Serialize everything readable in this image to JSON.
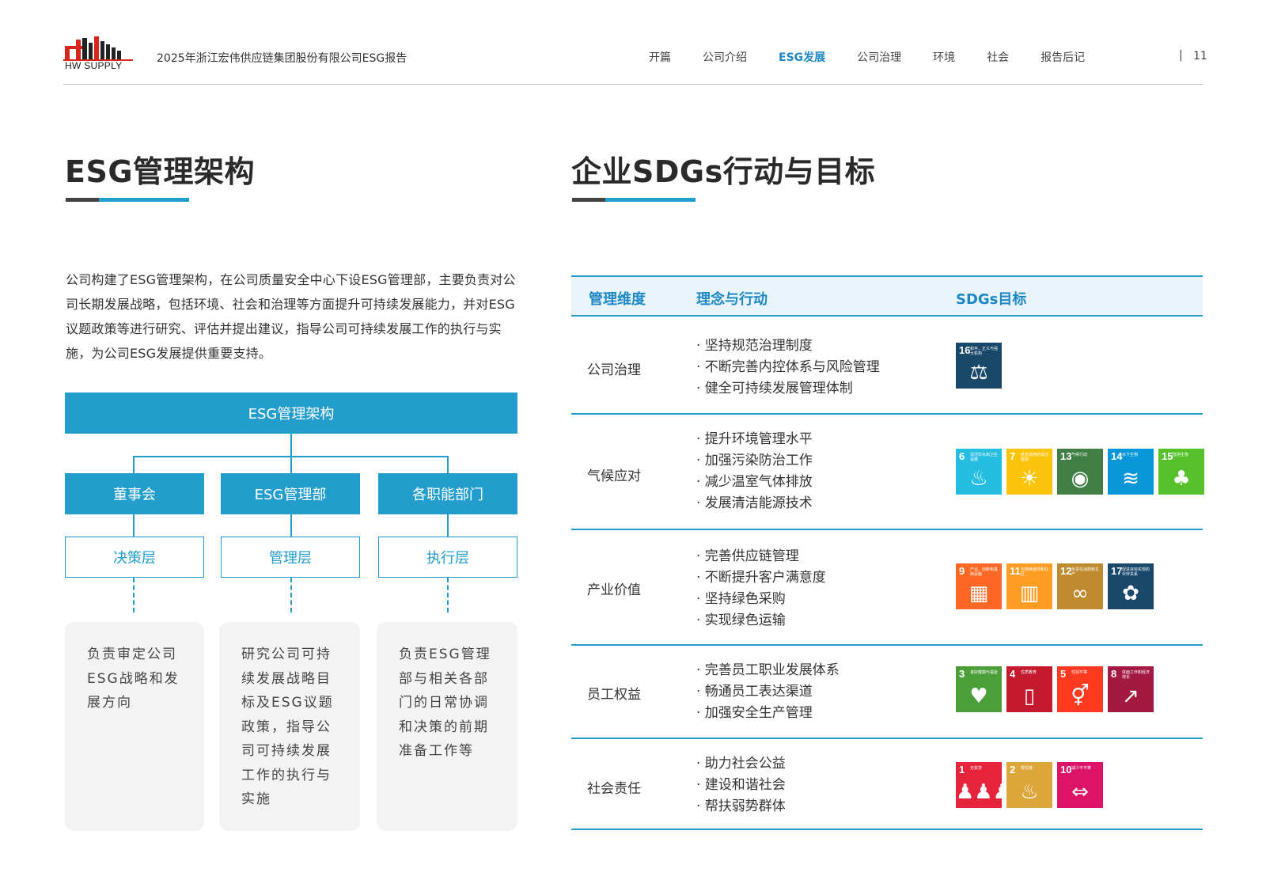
{
  "header": {
    "logo_text": "HW SUPPLY",
    "report_title": "2025年浙江宏伟供应链集团股份有限公司ESG报告",
    "nav": [
      {
        "label": "开篇",
        "active": false
      },
      {
        "label": "公司介绍",
        "active": false
      },
      {
        "label": "ESG发展",
        "active": true
      },
      {
        "label": "公司治理",
        "active": false
      },
      {
        "label": "环境",
        "active": false
      },
      {
        "label": "社会",
        "active": false
      },
      {
        "label": "报告后记",
        "active": false
      }
    ],
    "separator": "|",
    "page_number": "11"
  },
  "left": {
    "title": "ESG管理架构",
    "intro": "公司构建了ESG管理架构，在公司质量安全中心下设ESG管理部，主要负责对公司长期发展战略，包括环境、社会和治理等方面提升可持续发展能力，并对ESG议题政策等进行研究、评估并提出建议，指导公司可持续发展工作的执行与实施，为公司ESG发展提供重要支持。",
    "org": {
      "root": "ESG管理架构",
      "branches": [
        {
          "name": "董事会",
          "layer": "决策层",
          "desc": "负责审定公司ESG战略和发展方向"
        },
        {
          "name": "ESG管理部",
          "layer": "管理层",
          "desc": "研究公司可持续发展战略目标及ESG议题政策，指导公司可持续发展工作的执行与实施"
        },
        {
          "name": "各职能部门",
          "layer": "执行层",
          "desc": "负责ESG管理部与相关各部门的日常协调和决策的前期准备工作等"
        }
      ]
    }
  },
  "right": {
    "title": "企业SDGs行动与目标",
    "columns": [
      "管理维度",
      "理念与行动",
      "SDGs目标"
    ],
    "rows": [
      {
        "dimension": "公司治理",
        "actions": [
          "· 坚持规范治理制度",
          "· 不断完善内控体系与风险管理",
          "· 健全可持续发展管理体制"
        ],
        "sdgs": [
          {
            "num": "16",
            "label": "和平、正义与强大机构",
            "color": "#19486a",
            "icon": "dove-icon",
            "glyph": "⚖"
          }
        ]
      },
      {
        "dimension": "气候应对",
        "actions": [
          "· 提升环境管理水平",
          "· 加强污染防治工作",
          "· 减少温室气体排放",
          "· 发展清洁能源技术"
        ],
        "sdgs": [
          {
            "num": "6",
            "label": "清洁饮水和卫生设施",
            "color": "#26bde2",
            "icon": "water-icon",
            "glyph": "♨"
          },
          {
            "num": "7",
            "label": "经济适用的清洁能源",
            "color": "#fcc30b",
            "icon": "sun-icon",
            "glyph": "☀"
          },
          {
            "num": "13",
            "label": "气候行动",
            "color": "#3f7e44",
            "icon": "eye-globe-icon",
            "glyph": "◉"
          },
          {
            "num": "14",
            "label": "水下生物",
            "color": "#0a97d9",
            "icon": "fish-icon",
            "glyph": "≋"
          },
          {
            "num": "15",
            "label": "陆地生物",
            "color": "#56c02b",
            "icon": "tree-icon",
            "glyph": "♣"
          }
        ]
      },
      {
        "dimension": "产业价值",
        "actions": [
          "· 完善供应链管理",
          "· 不断提升客户满意度",
          "· 坚持绿色采购",
          "· 实现绿色运输"
        ],
        "sdgs": [
          {
            "num": "9",
            "label": "产业、创新和基础设施",
            "color": "#fd6925",
            "icon": "cubes-icon",
            "glyph": "▦"
          },
          {
            "num": "11",
            "label": "可持续城市和社区",
            "color": "#fd9d24",
            "icon": "city-icon",
            "glyph": "▥"
          },
          {
            "num": "12",
            "label": "负责任消费和生产",
            "color": "#bf8b2e",
            "icon": "infinity-icon",
            "glyph": "∞"
          },
          {
            "num": "17",
            "label": "促进目标实现的伙伴关系",
            "color": "#19486a",
            "icon": "flower-icon",
            "glyph": "✿"
          }
        ]
      },
      {
        "dimension": "员工权益",
        "actions": [
          "· 完善员工职业发展体系",
          "· 畅通员工表达渠道",
          "· 加强安全生产管理"
        ],
        "sdgs": [
          {
            "num": "3",
            "label": "良好健康与福祉",
            "color": "#4c9f38",
            "icon": "heartbeat-icon",
            "glyph": "♥"
          },
          {
            "num": "4",
            "label": "优质教育",
            "color": "#c5192d",
            "icon": "book-icon",
            "glyph": "▯"
          },
          {
            "num": "5",
            "label": "性别平等",
            "color": "#ff3a21",
            "icon": "gender-icon",
            "glyph": "⚥"
          },
          {
            "num": "8",
            "label": "体面工作和经济增长",
            "color": "#a21942",
            "icon": "growth-chart-icon",
            "glyph": "↗"
          }
        ]
      },
      {
        "dimension": "社会责任",
        "actions": [
          "· 助力社会公益",
          "· 建设和谐社会",
          "· 帮扶弱势群体"
        ],
        "sdgs": [
          {
            "num": "1",
            "label": "无贫穷",
            "color": "#e5243b",
            "icon": "family-icon",
            "glyph": "♟♟♟"
          },
          {
            "num": "2",
            "label": "零饥饿",
            "color": "#dda63a",
            "icon": "bowl-icon",
            "glyph": "♨"
          },
          {
            "num": "10",
            "label": "减少不平等",
            "color": "#dd1367",
            "icon": "equality-icon",
            "glyph": "⇔"
          }
        ]
      }
    ]
  }
}
